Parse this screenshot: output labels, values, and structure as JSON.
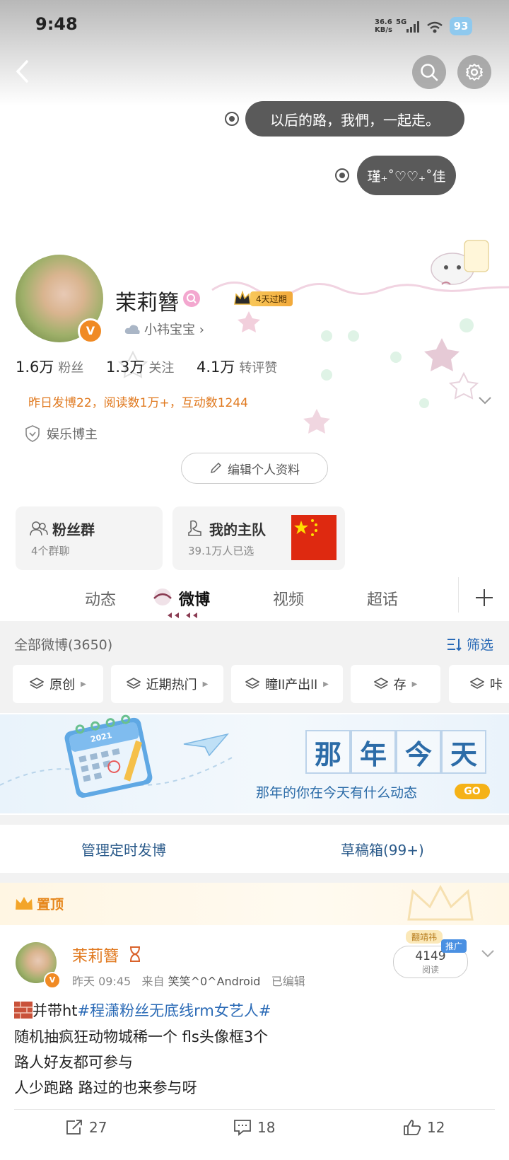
{
  "status_bar": {
    "time": "9:48",
    "net_speed": "36.6",
    "net_unit": "KB/s",
    "network": "5G",
    "battery": "93"
  },
  "header": {
    "bubble1": "以后的路，我們，一起走。",
    "bubble2": "瑾₊˚♡♡₊˚佳"
  },
  "profile": {
    "name": "茉莉簪",
    "expire_badge": "4天过期",
    "sub_label": "小祎宝宝 ›",
    "stats": [
      {
        "value": "1.6万",
        "label": "粉丝"
      },
      {
        "value": "1.3万",
        "label": "关注"
      },
      {
        "value": "4.1万",
        "label": "转评赞"
      }
    ],
    "activity": "昨日发博22，阅读数1万+，互动数1244",
    "tag": "娱乐博主",
    "edit_button": "编辑个人资料"
  },
  "cards": {
    "fans_group": {
      "title": "粉丝群",
      "sub": "4个群聊"
    },
    "home_team": {
      "title": "我的主队",
      "sub": "39.1万人已选"
    }
  },
  "tabs": [
    "动态",
    "微博",
    "视频",
    "超话"
  ],
  "filter": {
    "all_label": "全部微博(3650)",
    "filter_btn": "筛选",
    "chips": [
      "原创",
      "近期热门",
      "瞳ll产出ll",
      "存",
      "咔"
    ]
  },
  "banner": {
    "calendar_year": "2021",
    "title_chars": [
      "那",
      "年",
      "今",
      "天"
    ],
    "subtitle": "那年的你在今天有什么动态",
    "go": "GO"
  },
  "manage": {
    "scheduled": "管理定时发博",
    "drafts": "草稿箱(99+)"
  },
  "pinned": {
    "label": "置顶"
  },
  "post": {
    "author": "茉莉簪",
    "time": "昨天 09:45",
    "from_prefix": "来自",
    "source": "笑笑^0^Android",
    "edited": "已编辑",
    "read_count": "4149",
    "read_label": "阅读",
    "promo_tag": "推广",
    "promo_name": "翻靖祎",
    "line1_prefix": "并带ht",
    "hashtag": "#程潇粉丝无底线rm女艺人#",
    "line2": "随机抽疯狂动物城稀一个 fls头像框3个",
    "line3": "路人好友都可参与",
    "line4": "人少跑路 路过的也来参与呀",
    "reposts": "27",
    "comments": "18",
    "likes": "12"
  },
  "colors": {
    "accent_orange": "#e0791f",
    "link_blue": "#2a6ab6",
    "vip_orange": "#f08a24"
  }
}
